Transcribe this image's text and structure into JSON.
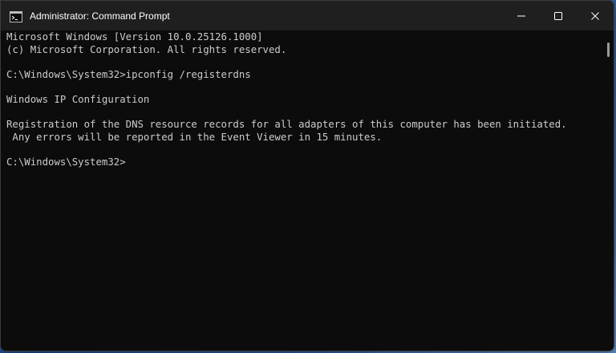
{
  "window": {
    "title": "Administrator: Command Prompt",
    "icon": "cmd-icon"
  },
  "caption": {
    "minimize_icon": "minimize-icon",
    "maximize_icon": "maximize-icon",
    "close_icon": "close-icon"
  },
  "console": {
    "lines": [
      "Microsoft Windows [Version 10.0.25126.1000]",
      "(c) Microsoft Corporation. All rights reserved.",
      "",
      "C:\\Windows\\System32>ipconfig /registerdns",
      "",
      "Windows IP Configuration",
      "",
      "Registration of the DNS resource records for all adapters of this computer has been initiated.",
      " Any errors will be reported in the Event Viewer in 15 minutes.",
      "",
      "C:\\Windows\\System32>"
    ]
  },
  "colors": {
    "console_background": "#0c0c0c",
    "console_text": "#cccccc",
    "titlebar_background": "#1f1f1f"
  }
}
